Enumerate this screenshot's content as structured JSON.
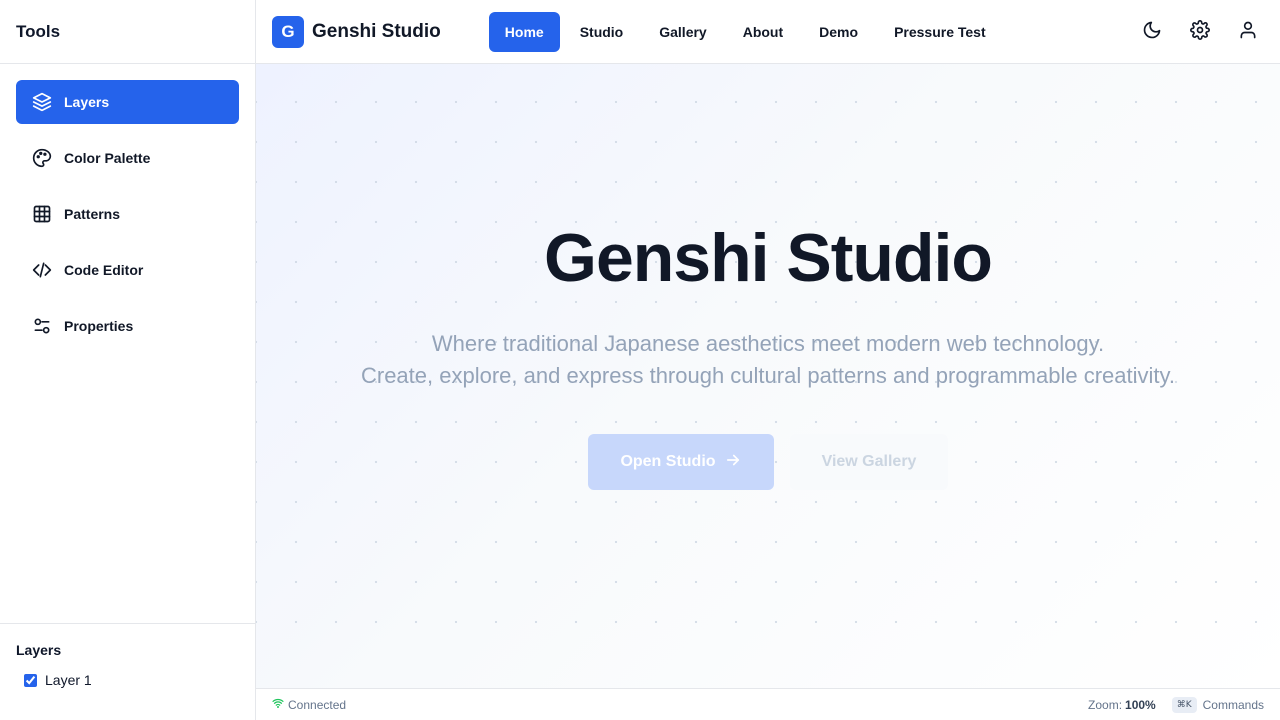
{
  "sidebar": {
    "title": "Tools",
    "items": [
      {
        "label": "Layers",
        "icon": "layers-icon",
        "active": true
      },
      {
        "label": "Color Palette",
        "icon": "palette-icon"
      },
      {
        "label": "Patterns",
        "icon": "grid-icon"
      },
      {
        "label": "Code Editor",
        "icon": "code-icon"
      },
      {
        "label": "Properties",
        "icon": "sliders-icon"
      }
    ],
    "layers_panel": {
      "title": "Layers",
      "items": [
        {
          "label": "Layer 1",
          "checked": true
        }
      ]
    }
  },
  "header": {
    "logo_letter": "G",
    "app_name": "Genshi Studio",
    "nav": [
      "Home",
      "Studio",
      "Gallery",
      "About",
      "Demo",
      "Pressure Test"
    ],
    "active_nav": "Home",
    "icons": [
      "moon-icon",
      "gear-icon",
      "user-icon"
    ]
  },
  "hero": {
    "title": "Genshi Studio",
    "subtitle_line1": "Where traditional Japanese aesthetics meet modern web technology.",
    "subtitle_line2": "Create, explore, and express through cultural patterns and programmable creativity.",
    "primary_button": "Open Studio",
    "secondary_button": "View Gallery"
  },
  "status": {
    "connection": "Connected",
    "zoom_label": "Zoom:",
    "zoom_value": "100%",
    "shortcut": "⌘K",
    "commands": "Commands"
  },
  "colors": {
    "accent": "#2563eb",
    "connected": "#22c55e"
  }
}
